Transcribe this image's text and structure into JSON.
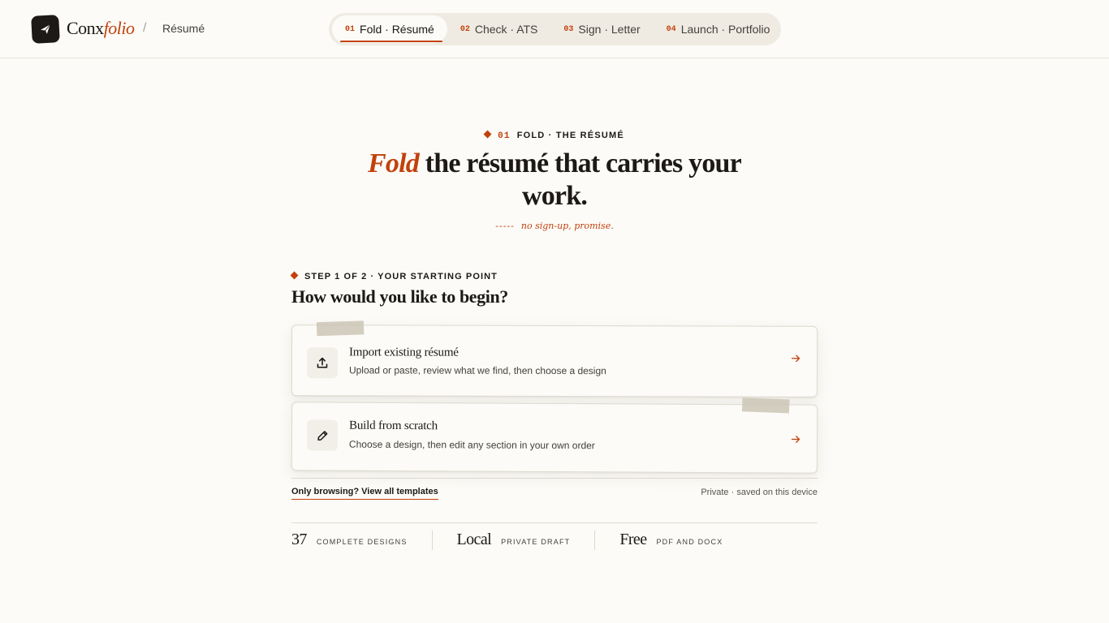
{
  "brand": {
    "name_plain": "Conx",
    "name_em": "folio"
  },
  "breadcrumb": {
    "separator": "/",
    "current": "Résumé"
  },
  "tabs": [
    {
      "num": "01",
      "label": "Fold · Résumé",
      "active": true
    },
    {
      "num": "02",
      "label": "Check · ATS",
      "active": false
    },
    {
      "num": "03",
      "label": "Sign · Letter",
      "active": false
    },
    {
      "num": "04",
      "label": "Launch · Portfolio",
      "active": false
    }
  ],
  "hero": {
    "eyebrow_num": "01",
    "eyebrow_label": "FOLD · THE RÉSUMÉ",
    "headline_em": "Fold",
    "headline_rest": " the résumé that carries your work.",
    "note_dash": "-----",
    "note": "no sign-up, promise."
  },
  "step": {
    "eyebrow": "STEP 1 OF 2 · YOUR STARTING POINT",
    "title": "How would you like to begin?"
  },
  "options": [
    {
      "icon": "upload-icon",
      "title": "Import existing résumé",
      "subtitle": "Upload or paste, review what we find, then choose a design"
    },
    {
      "icon": "pencil-icon",
      "title": "Build from scratch",
      "subtitle": "Choose a design, then edit any section in your own order"
    }
  ],
  "footer": {
    "browse_link": "Only browsing? View all templates",
    "private_note": "Private · saved on this device"
  },
  "stats": [
    {
      "value": "37",
      "label": "COMPLETE DESIGNS"
    },
    {
      "value": "Local",
      "label": "PRIVATE DRAFT"
    },
    {
      "value": "Free",
      "label": "PDF AND DOCX"
    }
  ],
  "colors": {
    "accent": "#c2410c",
    "background": "#fcfbf7",
    "text": "#1c1917"
  }
}
